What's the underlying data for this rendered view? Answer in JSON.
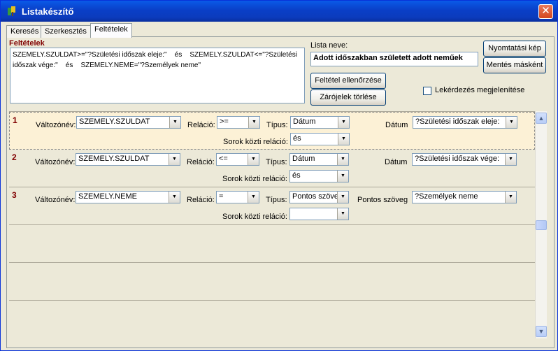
{
  "window": {
    "title": "Listakészítő",
    "close_glyph": "✕",
    "icon": "app-icon"
  },
  "tabs": [
    {
      "label": "Keresés"
    },
    {
      "label": "Szerkesztés"
    },
    {
      "label": "Feltételek"
    }
  ],
  "conditions_section": {
    "label": "Feltételek",
    "expression": "SZEMELY.SZULDAT>=\"?Születési időszak eleje:\"    és    SZEMELY.SZULDAT<=\"?Születési időszak vége:\"    és    SZEMELY.NEME=\"?Személyek neme\""
  },
  "list_name": {
    "label": "Lista neve:",
    "value": "Adott időszakban született adott neműek"
  },
  "buttons": {
    "print_view": "Nyomtatási kép",
    "save_as": "Mentés másként",
    "check_condition": "Feltétel ellenőrzése",
    "clear_brackets": "Zárójelek törlése"
  },
  "show_query": {
    "label": "Lekérdezés megjelenítése",
    "checked": false
  },
  "field_labels": {
    "variable": "Változónév:",
    "relation": "Reláció:",
    "type": "Típus:",
    "row_relation": "Sorok közti reláció:"
  },
  "rows": [
    {
      "num": "1",
      "variable": "SZEMELY.SZULDAT",
      "relation": ">=",
      "type": "Dátum",
      "row_relation": "és",
      "value_label": "Dátum",
      "value": "?Születési időszak eleje:"
    },
    {
      "num": "2",
      "variable": "SZEMELY.SZULDAT",
      "relation": "<=",
      "type": "Dátum",
      "row_relation": "és",
      "value_label": "Dátum",
      "value": "?Születési időszak vége:"
    },
    {
      "num": "3",
      "variable": "SZEMELY.NEME",
      "relation": "=",
      "type": "Pontos szöve",
      "row_relation": "",
      "value_label": "Pontos szöveg",
      "value": "?Személyek neme"
    }
  ],
  "scrollbar": {
    "up": "▲",
    "down": "▼"
  },
  "colors": {
    "accent_label": "#800000",
    "selected_row": "#fcf1d6"
  }
}
